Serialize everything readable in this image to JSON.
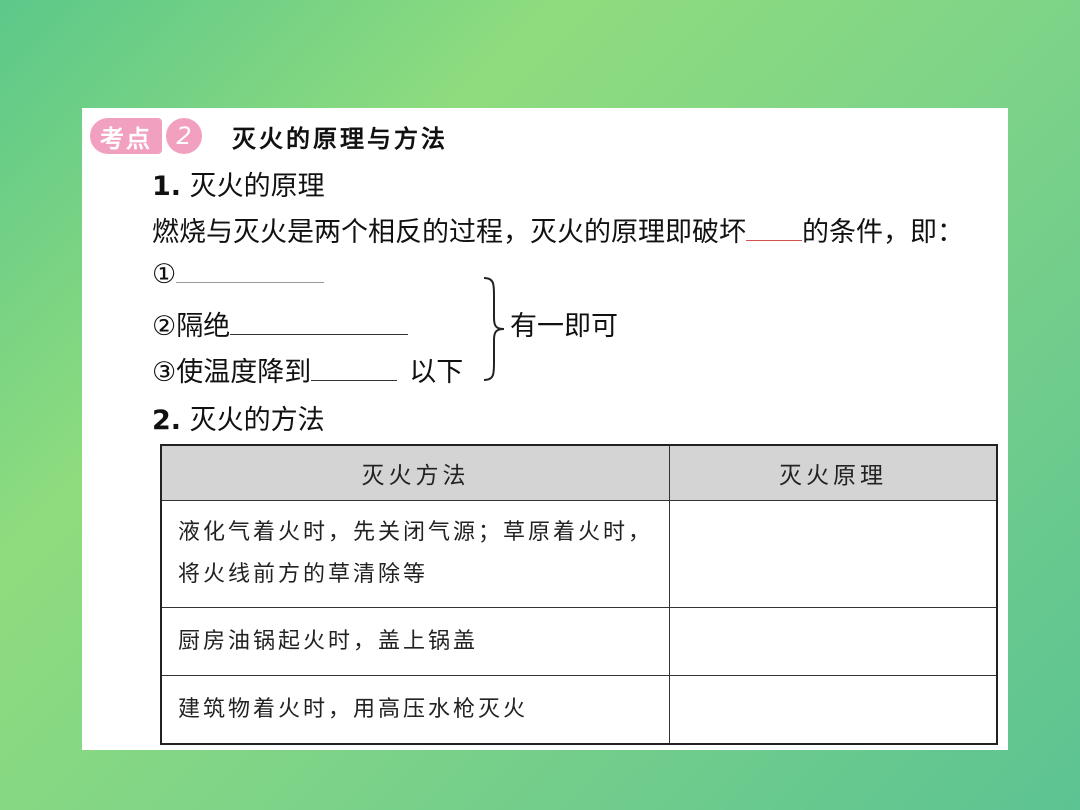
{
  "header": {
    "badge_word": "考点",
    "badge_num": "2",
    "title": "灭火的原理与方法"
  },
  "section1": {
    "heading_num": "1.",
    "heading_text": "灭火的原理",
    "sentence_start": "燃烧与灭火是两个相反的过程，灭火的原理即破坏",
    "sentence_end": "的条件，即：",
    "item1_marker": "①",
    "item2_label": "②隔绝",
    "item3_label": "③使温度降到",
    "item3_suffix": "以下",
    "brace_note": "有一即可"
  },
  "section2": {
    "heading_num": "2.",
    "heading_text": "灭火的方法"
  },
  "table": {
    "headers": [
      "灭火方法",
      "灭火原理"
    ],
    "rows": [
      [
        "液化气着火时，先关闭气源；草原着火时，将火线前方的草清除等",
        ""
      ],
      [
        "厨房油锅起火时，盖上锅盖",
        ""
      ],
      [
        "建筑物着火时，用高压水枪灭火",
        ""
      ]
    ]
  },
  "colors": {
    "badge": "#f2a0c0",
    "background_green": "#7fd487",
    "table_header": "#d4d4d4"
  }
}
